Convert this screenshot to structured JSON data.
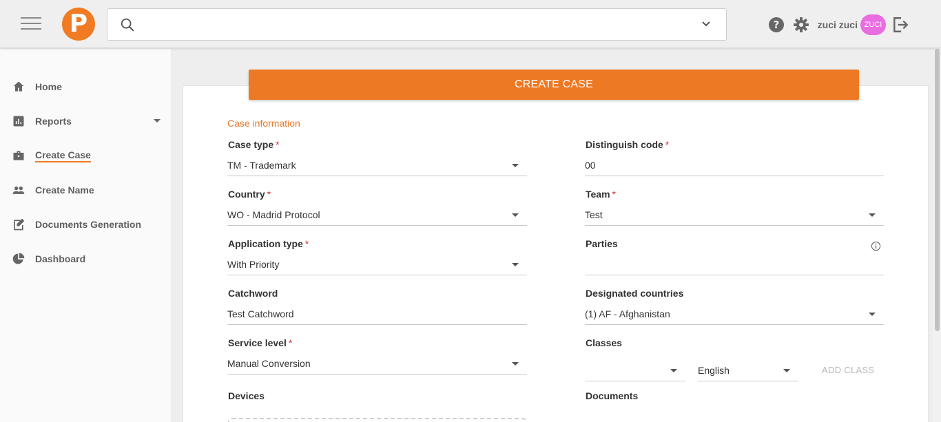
{
  "header": {
    "logo_letter": "P",
    "search_placeholder": "",
    "username": "zuci zuci",
    "avatar_text": "ZUCI"
  },
  "sidebar": {
    "items": [
      {
        "label": "Home",
        "icon": "home-icon"
      },
      {
        "label": "Reports",
        "icon": "bar-chart-icon"
      },
      {
        "label": "Create Case",
        "icon": "briefcase-icon"
      },
      {
        "label": "Create Name",
        "icon": "people-icon"
      },
      {
        "label": "Documents Generation",
        "icon": "edit-document-icon"
      },
      {
        "label": "Dashboard",
        "icon": "pie-chart-icon"
      }
    ]
  },
  "main": {
    "create_button": "CREATE CASE",
    "section_title": "Case information",
    "case_type": {
      "label": "Case type",
      "value": "TM - Trademark"
    },
    "distinguish_code": {
      "label": "Distinguish code",
      "value": "00"
    },
    "country": {
      "label": "Country",
      "value": "WO - Madrid Protocol"
    },
    "team": {
      "label": "Team",
      "value": "Test"
    },
    "application_type": {
      "label": "Application type",
      "value": "With Priority"
    },
    "parties": {
      "label": "Parties",
      "value": ""
    },
    "catchword": {
      "label": "Catchword",
      "value": "Test Catchword"
    },
    "designated_countries": {
      "label": "Designated countries",
      "value": "(1) AF - Afghanistan"
    },
    "service_level": {
      "label": "Service level",
      "value": "Manual Conversion"
    },
    "classes": {
      "label": "Classes",
      "class_value": "",
      "language_value": "English",
      "add_button": "ADD CLASS"
    },
    "devices": {
      "label": "Devices"
    },
    "documents": {
      "label": "Documents"
    },
    "required_mark": "*"
  },
  "colors": {
    "accent": "#ee7924",
    "avatar": "#e86de0",
    "required": "#d32f2f"
  }
}
